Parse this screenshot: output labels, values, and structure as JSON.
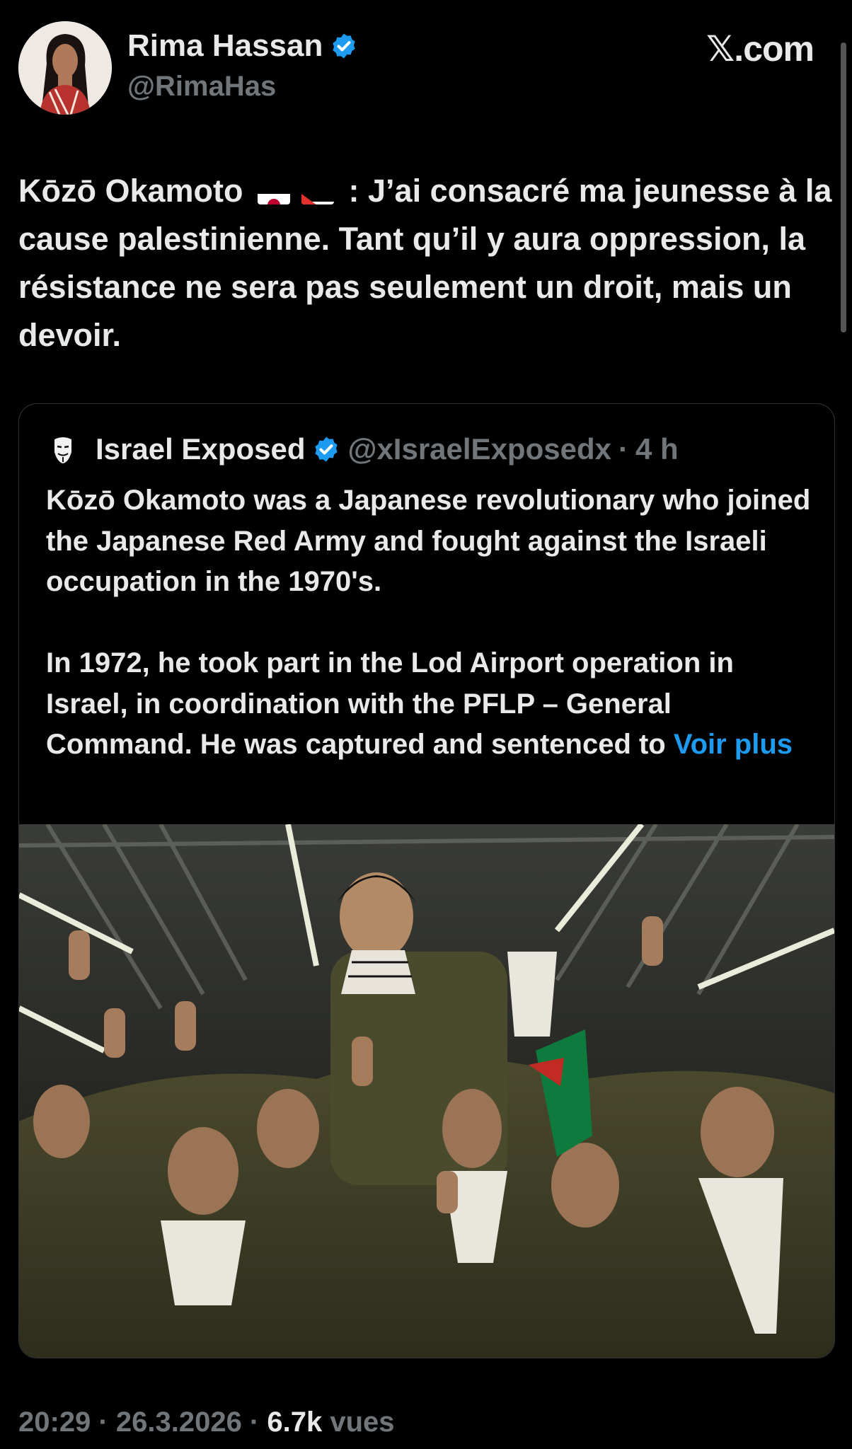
{
  "author": {
    "name": "Rima Hassan",
    "handle": "@RimaHas",
    "verified": true
  },
  "brand": "𝕏.com",
  "tweet": {
    "text_before_flags": "Kōzō Okamoto",
    "flags": [
      "japan-flag",
      "palestine-flag"
    ],
    "text_after_flags": " : J’ai consacré ma jeunesse à la cause palestinienne. Tant qu’il y aura oppression, la résistance ne sera pas seulement un droit, mais un devoir."
  },
  "quoted": {
    "name": "Israel Exposed",
    "handle": "@xIsraelExposedx",
    "separator": "·",
    "time": "4 h",
    "text": "Kōzō Okamoto was a Japanese revolutionary who joined the Japanese Red Army and fought against the Israeli occupation in the 1970's.\n\nIn 1972, he took part in the Lod Airport operation in Israel, in coordination with the PFLP – General Command. He was captured and sentenced to ",
    "more_label": "Voir plus",
    "media": "group-photo"
  },
  "footer": {
    "time": "20:29",
    "separator": " · ",
    "date": "26.3.2026",
    "views_count": "6.7k",
    "views_label": " vues"
  },
  "colors": {
    "background": "#000000",
    "text": "#e7e9ea",
    "muted": "#71767b",
    "link": "#1d9bf0",
    "verified": "#1d9bf0",
    "border": "#2f3336"
  }
}
